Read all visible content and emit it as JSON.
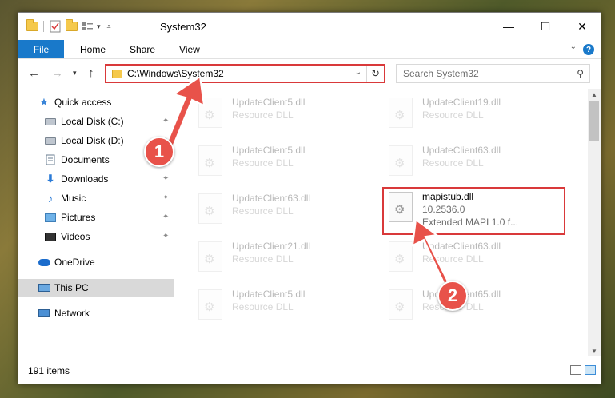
{
  "window": {
    "title": "System32",
    "controls": {
      "minimize": "—",
      "maximize": "☐",
      "close": "✕"
    }
  },
  "ribbon": {
    "tabs": [
      "File",
      "Home",
      "Share",
      "View"
    ],
    "help": "?"
  },
  "nav": {
    "address": "C:\\Windows\\System32",
    "search_placeholder": "Search System32"
  },
  "sidebar": {
    "items": [
      {
        "label": "Quick access",
        "icon": "star-icon"
      },
      {
        "label": "Local Disk (C:)",
        "icon": "drive-icon"
      },
      {
        "label": "Local Disk (D:)",
        "icon": "drive-icon"
      },
      {
        "label": "Documents",
        "icon": "documents-icon"
      },
      {
        "label": "Downloads",
        "icon": "download-icon"
      },
      {
        "label": "Music",
        "icon": "music-icon"
      },
      {
        "label": "Pictures",
        "icon": "pictures-icon"
      },
      {
        "label": "Videos",
        "icon": "videos-icon"
      },
      {
        "label": "OneDrive",
        "icon": "cloud-icon"
      },
      {
        "label": "This PC",
        "icon": "computer-icon"
      },
      {
        "label": "Network",
        "icon": "network-icon"
      }
    ]
  },
  "files": [
    {
      "name": "UpdateClient5.dll",
      "sub1": "Resource DLL",
      "sub2": ""
    },
    {
      "name": "UpdateClient19.dll",
      "sub1": "Resource DLL",
      "sub2": ""
    },
    {
      "name": "UpdateClient5.dll",
      "sub1": "Resource DLL",
      "sub2": ""
    },
    {
      "name": "UpdateClient63.dll",
      "sub1": "Resource DLL",
      "sub2": ""
    },
    {
      "name": "UpdateClient63.dll",
      "sub1": "Resource DLL",
      "sub2": ""
    },
    {
      "name": "mapistub.dll",
      "sub1": "10.2536.0",
      "sub2": "Extended MAPI 1.0 f..."
    },
    {
      "name": "UpdateClient21.dll",
      "sub1": "Resource DLL",
      "sub2": ""
    },
    {
      "name": "UpdateClient63.dll",
      "sub1": "Resource DLL",
      "sub2": ""
    },
    {
      "name": "UpdateClient5.dll",
      "sub1": "Resource DLL",
      "sub2": ""
    },
    {
      "name": "UpdateClient65.dll",
      "sub1": "Resource DLL",
      "sub2": ""
    }
  ],
  "status": {
    "count": "191 items"
  },
  "annotations": {
    "badge1": "1",
    "badge2": "2",
    "accent": "#e8524a"
  }
}
